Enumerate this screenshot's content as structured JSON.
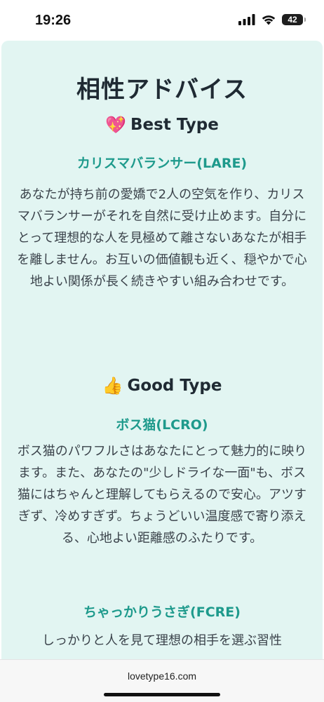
{
  "status_bar": {
    "time": "19:26",
    "battery": "42",
    "icons": [
      "signal-icon",
      "wifi-icon",
      "battery-icon"
    ]
  },
  "page": {
    "title": "相性アドバイス"
  },
  "best": {
    "emoji": "💖",
    "heading": "Best Type",
    "type_name": "カリスマバランサー(LARE)",
    "description": "あなたが持ち前の愛嬌で2人の空気を作り、カリスマバランサーがそれを自然に受け止めます。自分にとって理想的な人を見極めて離さないあなたが相手を離しません。お互いの価値観も近く、穏やかで心地よい関係が長く続きやすい組み合わせです。"
  },
  "good": {
    "emoji": "👍",
    "heading": "Good Type",
    "types": [
      {
        "name": "ボス猫(LCRO)",
        "description": "ボス猫のパワフルさはあなたにとって魅力的に映ります。また、あなたの\"少しドライな一面\"も、ボス猫にはちゃんと理解してもらえるので安心。アツすぎず、冷めすぎず。ちょうどいい温度感で寄り添える、心地よい距離感のふたりです。"
      },
      {
        "name": "ちゃっかりうさぎ(FCRE)",
        "description": "しっかりと人を見て理想の相手を選ぶ習性"
      }
    ]
  },
  "browser": {
    "url": "lovetype16.com"
  },
  "colors": {
    "card_background": "#e2f5f2",
    "accent": "#1e9a8c",
    "heading": "#1f2a33"
  }
}
